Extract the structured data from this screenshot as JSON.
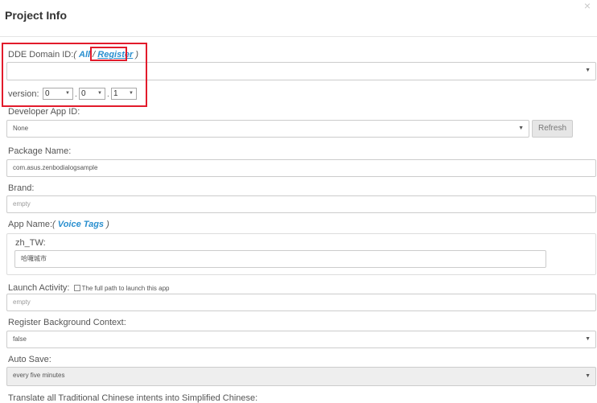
{
  "modal": {
    "title": "Project Info",
    "close_glyph": "×"
  },
  "dde": {
    "label": "DDE Domain ID:",
    "open_paren": "(",
    "all_link": "All",
    "separator": "/",
    "register_link": "Register",
    "close_paren": ")",
    "value": ""
  },
  "version": {
    "label": "version:",
    "major": "0",
    "minor": "0",
    "patch": "1"
  },
  "developer_app": {
    "label": "Developer App ID:",
    "value": "None",
    "refresh_button": "Refresh"
  },
  "package": {
    "label": "Package Name:",
    "value": "com.asus.zenbodialogsample"
  },
  "brand": {
    "label": "Brand:",
    "placeholder": "empty"
  },
  "app_name": {
    "label": "App Name:",
    "open_paren": "(",
    "voice_tags_link": "Voice Tags",
    "close_paren": ")",
    "locale_label": "zh_TW:",
    "locale_value": "哈囉城市"
  },
  "launch_activity": {
    "label": "Launch Activity:",
    "checkbox_label": "The full path to launch this app",
    "placeholder": "empty"
  },
  "register_bg": {
    "label": "Register Background Context:",
    "value": "false"
  },
  "auto_save": {
    "label": "Auto Save:",
    "value": "every five minutes"
  },
  "translate": {
    "label": "Translate all Traditional Chinese intents into Simplified Chinese:"
  },
  "icons": {
    "caret": "dropdown-caret-icon",
    "close": "close-icon"
  },
  "colors": {
    "link": "#2a8fcf",
    "highlight": "#e21b2b",
    "disabled_bg": "#eeeeee"
  }
}
